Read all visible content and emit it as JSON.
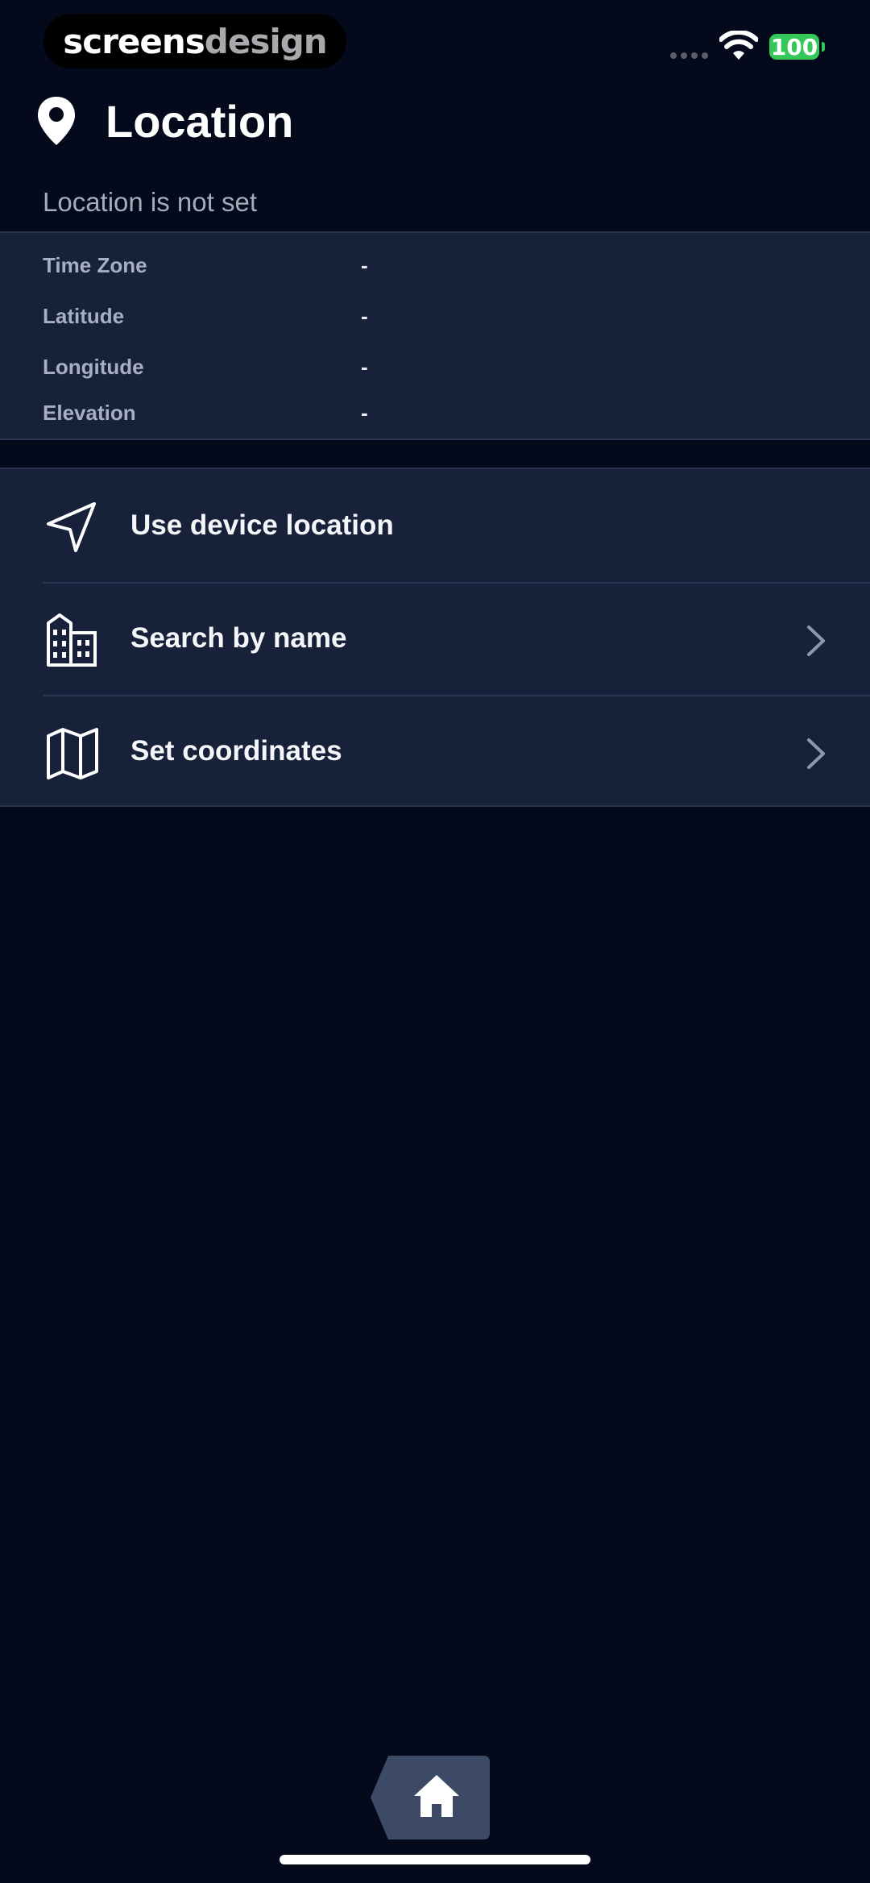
{
  "status_bar": {
    "brand_primary": "screens",
    "brand_secondary": "design",
    "battery_level": "100",
    "battery_color": "#34c759"
  },
  "header": {
    "title": "Location",
    "icon": "map-pin-icon"
  },
  "location_status": "Location is not set",
  "details": [
    {
      "label": "Time Zone",
      "value": "-"
    },
    {
      "label": "Latitude",
      "value": "-"
    },
    {
      "label": "Longitude",
      "value": "-"
    },
    {
      "label": "Elevation",
      "value": "-"
    }
  ],
  "actions": [
    {
      "label": "Use device location",
      "icon": "navigation-arrow-icon",
      "has_chevron": false
    },
    {
      "label": "Search by name",
      "icon": "buildings-icon",
      "has_chevron": true
    },
    {
      "label": "Set coordinates",
      "icon": "map-icon",
      "has_chevron": true
    }
  ],
  "bottom_nav": {
    "home_icon": "home-icon"
  },
  "colors": {
    "background": "#040a1b",
    "panel": "#18213a",
    "muted_text": "#a4acba",
    "home_button": "#3c4a66"
  }
}
